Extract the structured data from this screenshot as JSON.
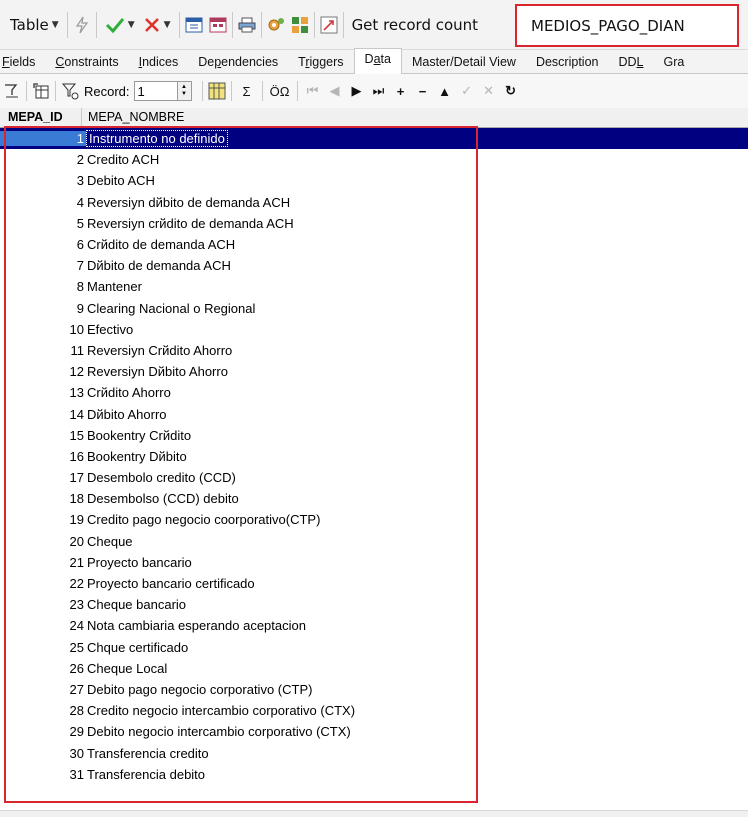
{
  "toolbar": {
    "table_label": "Table",
    "get_record_count_label": "Get record count",
    "table_name": "MEDIOS_PAGO_DIAN"
  },
  "tabs": [
    {
      "label": "Fields",
      "active": false
    },
    {
      "label": "Constraints",
      "active": false
    },
    {
      "label": "Indices",
      "active": false
    },
    {
      "label": "Dependencies",
      "active": false
    },
    {
      "label": "Triggers",
      "active": false
    },
    {
      "label": "Data",
      "active": true
    },
    {
      "label": "Master/Detail View",
      "active": false
    },
    {
      "label": "Description",
      "active": false
    },
    {
      "label": "DDL",
      "active": false
    },
    {
      "label": "Gra",
      "active": false
    }
  ],
  "data_toolbar": {
    "record_label": "Record:",
    "record_value": "1",
    "sigma": "Σ",
    "omega": "ÖΩ"
  },
  "grid": {
    "columns": [
      "MEPA_ID",
      "MEPA_NOMBRE"
    ],
    "rows": [
      {
        "id": "1",
        "name": "Instrumento no definido"
      },
      {
        "id": "2",
        "name": "Credito ACH"
      },
      {
        "id": "3",
        "name": "Debito ACH"
      },
      {
        "id": "4",
        "name": "Reversiyn dйbito de demanda ACH"
      },
      {
        "id": "5",
        "name": "Reversiyn crйdito de demanda ACH"
      },
      {
        "id": "6",
        "name": "Crйdito de demanda ACH"
      },
      {
        "id": "7",
        "name": "Dйbito de demanda ACH"
      },
      {
        "id": "8",
        "name": "Mantener"
      },
      {
        "id": "9",
        "name": "Clearing Nacional o Regional"
      },
      {
        "id": "10",
        "name": "Efectivo"
      },
      {
        "id": "11",
        "name": "Reversiyn Crйdito Ahorro"
      },
      {
        "id": "12",
        "name": "Reversiyn Dйbito Ahorro"
      },
      {
        "id": "13",
        "name": "Crйdito Ahorro"
      },
      {
        "id": "14",
        "name": "Dйbito Ahorro"
      },
      {
        "id": "15",
        "name": "Bookentry Crйdito"
      },
      {
        "id": "16",
        "name": "Bookentry Dйbito"
      },
      {
        "id": "17",
        "name": "Desembolo credito (CCD)"
      },
      {
        "id": "18",
        "name": "Desembolso (CCD) debito"
      },
      {
        "id": "19",
        "name": "Credito pago negocio coorporativo(CTP)"
      },
      {
        "id": "20",
        "name": "Cheque"
      },
      {
        "id": "21",
        "name": "Proyecto bancario"
      },
      {
        "id": "22",
        "name": "Proyecto bancario certificado"
      },
      {
        "id": "23",
        "name": "Cheque bancario"
      },
      {
        "id": "24",
        "name": "Nota cambiaria esperando aceptacion"
      },
      {
        "id": "25",
        "name": "Chque certificado"
      },
      {
        "id": "26",
        "name": "Cheque Local"
      },
      {
        "id": "27",
        "name": "Debito pago negocio corporativo (CTP)"
      },
      {
        "id": "28",
        "name": "Credito negocio intercambio corporativo (CTX)"
      },
      {
        "id": "29",
        "name": "Debito negocio intercambio corporativo (CTX)"
      },
      {
        "id": "30",
        "name": "Transferencia credito"
      },
      {
        "id": "31",
        "name": "Transferencia debito"
      }
    ]
  },
  "colors": {
    "highlight": "#d9252d",
    "selection": "#000080"
  }
}
